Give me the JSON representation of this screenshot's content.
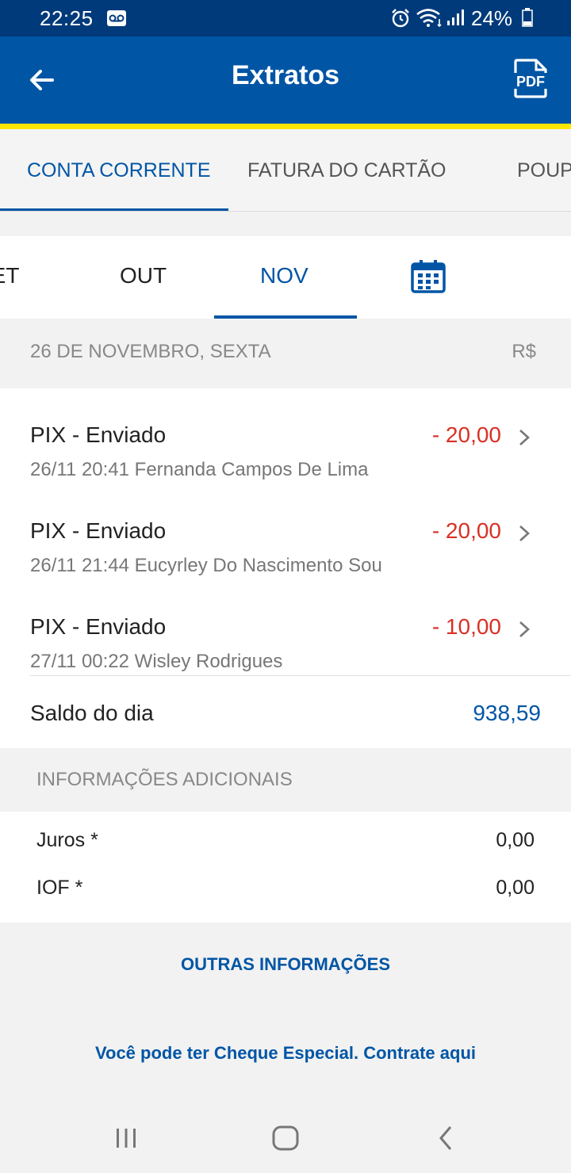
{
  "status_bar": {
    "time": "22:25",
    "battery": "24%"
  },
  "app_bar": {
    "title": "Extratos"
  },
  "tabs": [
    {
      "label": "CONTA CORRENTE",
      "active": true
    },
    {
      "label": "FATURA DO CARTÃO",
      "active": false
    },
    {
      "label": "POUPANÇA",
      "active": false
    }
  ],
  "months": [
    {
      "label": "SET",
      "active": false
    },
    {
      "label": "OUT",
      "active": false
    },
    {
      "label": "NOV",
      "active": true
    }
  ],
  "day_header": {
    "date": "26 DE NOVEMBRO, SEXTA",
    "currency": "R$"
  },
  "transactions": [
    {
      "title": "PIX - Enviado",
      "description": "26/11 20:41 Fernanda Campos De Lima",
      "amount": "- 20,00"
    },
    {
      "title": "PIX - Enviado",
      "description": "26/11 21:44 Eucyrley Do Nascimento Sou",
      "amount": "- 20,00"
    },
    {
      "title": "PIX - Enviado",
      "description": "27/11 00:22 Wisley Rodrigues",
      "amount": "- 10,00"
    }
  ],
  "saldo": {
    "label": "Saldo do dia",
    "value": "938,59"
  },
  "info": {
    "header": "INFORMAÇÕES ADICIONAIS",
    "rows": [
      {
        "label": "Juros *",
        "value": "0,00"
      },
      {
        "label": "IOF *",
        "value": "0,00"
      }
    ]
  },
  "links": {
    "outras": "OUTRAS INFORMAÇÕES",
    "cheque": "Você pode ter Cheque Especial. Contrate aqui"
  },
  "colors": {
    "primary": "#0055a5",
    "status_bar": "#003a7a",
    "accent": "#ffe600",
    "negative": "#d93025"
  }
}
